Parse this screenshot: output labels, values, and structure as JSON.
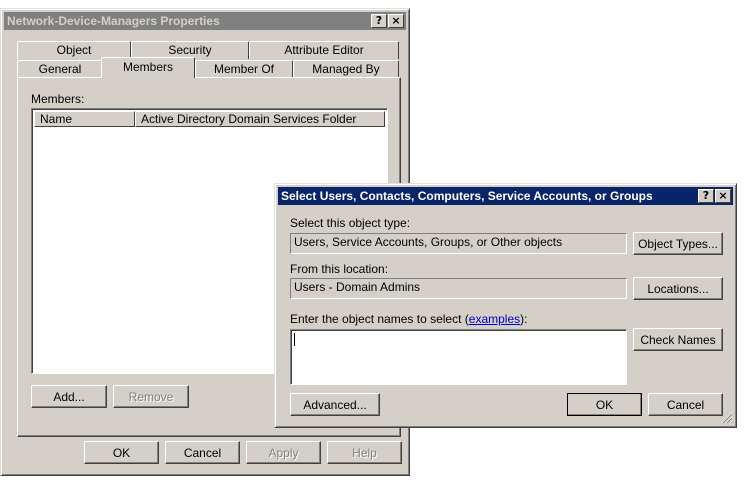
{
  "properties_dialog": {
    "title": "Network-Device-Managers Properties",
    "help_glyph": "?",
    "close_glyph": "×",
    "tabs_back": [
      "Object",
      "Security",
      "Attribute Editor"
    ],
    "tabs_front": [
      "General",
      "Members",
      "Member Of",
      "Managed By"
    ],
    "selected_tab": "Members",
    "members_label": "Members:",
    "columns": [
      "Name",
      "Active Directory Domain Services Folder"
    ],
    "add_button": "Add...",
    "remove_button": "Remove",
    "ok_button": "OK",
    "cancel_button": "Cancel",
    "apply_button": "Apply",
    "help_button": "Help"
  },
  "select_dialog": {
    "title": "Select Users, Contacts, Computers, Service Accounts, or Groups",
    "help_glyph": "?",
    "close_glyph": "×",
    "object_type_label": "Select this object type:",
    "object_type_value": "Users, Service Accounts, Groups, or Other objects",
    "object_types_button": "Object Types...",
    "location_label": "From this location:",
    "location_value": "Users - Domain Admins",
    "locations_button": "Locations...",
    "enter_names_label": "Enter the object names to select (",
    "examples_link": "examples",
    "enter_names_suffix": "):",
    "names_value": "",
    "check_names_button": "Check Names",
    "advanced_button": "Advanced...",
    "ok_button": "OK",
    "cancel_button": "Cancel"
  }
}
